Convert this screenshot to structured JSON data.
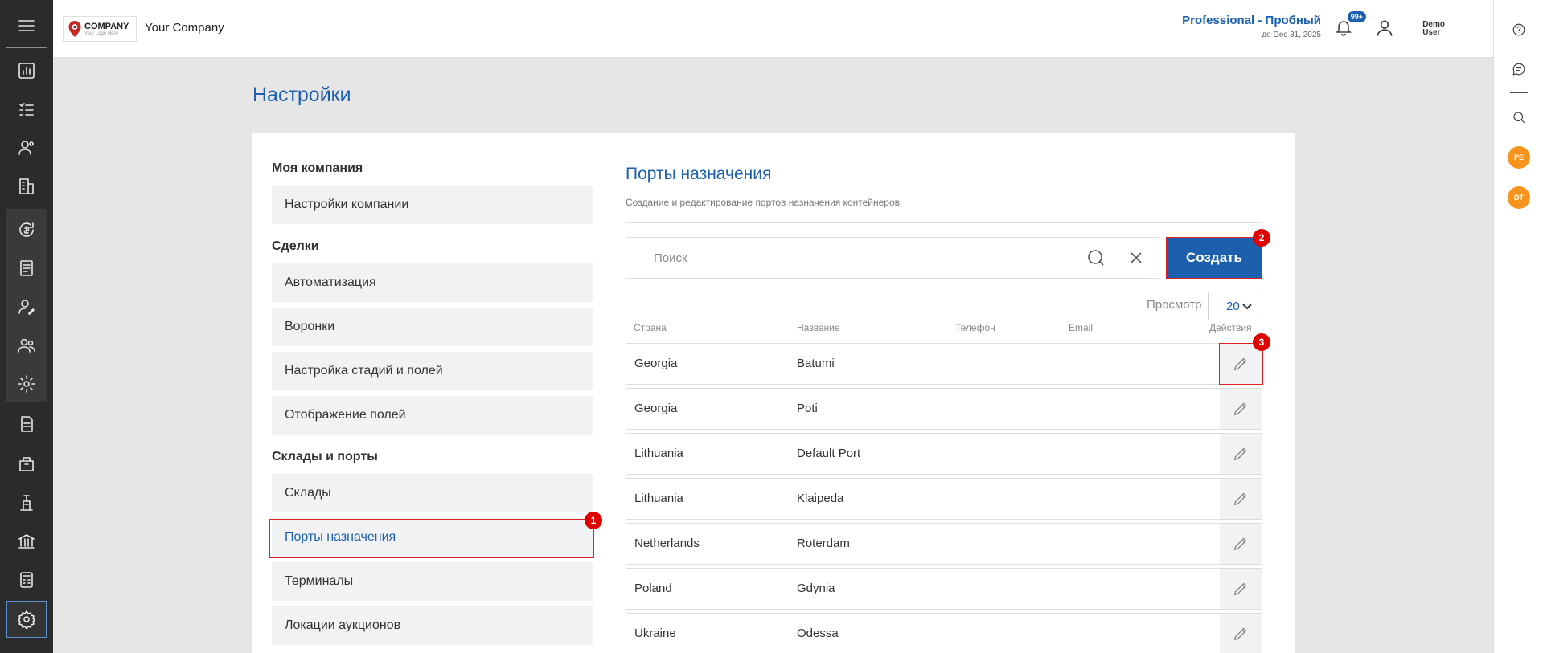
{
  "header": {
    "logo_text": "COMPANY",
    "logo_tagline": "Your Logo Here",
    "company_name": "Your Company",
    "plan_name": "Professional - Пробный",
    "plan_until": "до Dec 31, 2025",
    "notifications_badge": "99+",
    "user_line1": "Demo",
    "user_line2": "User"
  },
  "right_rail": {
    "avatar1": "PE",
    "avatar2": "DT"
  },
  "page_title": "Настройки",
  "settings_menu": {
    "sections": [
      {
        "title": "Моя компания",
        "items": [
          "Настройки компании"
        ]
      },
      {
        "title": "Сделки",
        "items": [
          "Автоматизация",
          "Воронки",
          "Настройка стадий и полей",
          "Отображение полей"
        ]
      },
      {
        "title": "Склады и порты",
        "items": [
          "Склады",
          "Порты назначения",
          "Терминалы",
          "Локации аукционов"
        ]
      }
    ],
    "active_item": "Порты назначения"
  },
  "panel": {
    "title": "Порты назначения",
    "subtitle": "Создание и редактирование портов назначения контейнеров",
    "search_placeholder": "Поиск",
    "create_label": "Создать",
    "view_label": "Просмотр",
    "page_size": "20",
    "columns": [
      "Страна",
      "Название",
      "Телефон",
      "Email",
      "Действия"
    ],
    "rows": [
      {
        "country": "Georgia",
        "name": "Batumi"
      },
      {
        "country": "Georgia",
        "name": "Poti"
      },
      {
        "country": "Lithuania",
        "name": "Default Port"
      },
      {
        "country": "Lithuania",
        "name": "Klaipeda"
      },
      {
        "country": "Netherlands",
        "name": "Roterdam"
      },
      {
        "country": "Poland",
        "name": "Gdynia"
      },
      {
        "country": "Ukraine",
        "name": "Odessa"
      }
    ]
  },
  "annotations": [
    "1",
    "2",
    "3"
  ],
  "colors": {
    "accent": "#1b5fad",
    "sidebar": "#2b2b2b",
    "highlight": "#e02020"
  }
}
